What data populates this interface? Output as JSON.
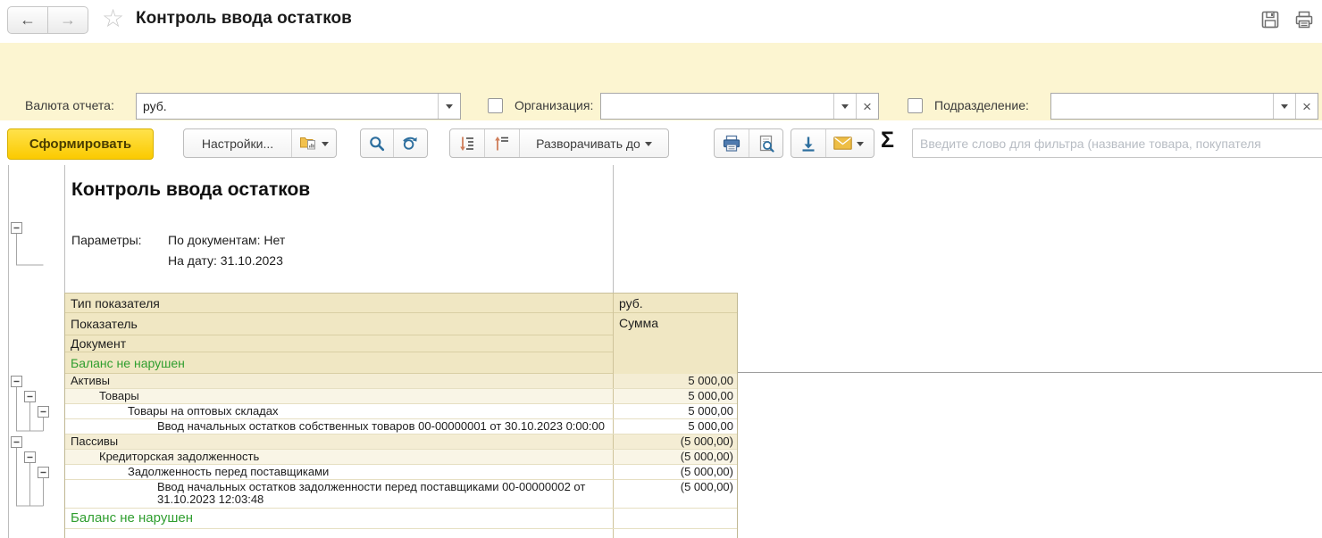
{
  "header": {
    "title": "Контроль ввода остатков",
    "back_glyph": "←",
    "forward_glyph": "→",
    "star_glyph": "☆"
  },
  "filters": {
    "currency": {
      "label": "Валюта отчета:",
      "value": "руб."
    },
    "organization": {
      "label": "Организация:",
      "value": "",
      "checked": false
    },
    "department": {
      "label": "Подразделение:",
      "value": "",
      "checked": false
    },
    "date": {
      "label": "На дату:",
      "value": "31.10.2023"
    }
  },
  "toolbar": {
    "generate_label": "Сформировать",
    "settings_label": "Настройки...",
    "expand_to_label": "Разворачивать до",
    "sigma": "Σ",
    "filter_placeholder": "Введите слово для фильтра (название товара, покупателя"
  },
  "report": {
    "title": "Контроль ввода остатков",
    "parameters_label": "Параметры:",
    "parameter_documents": "По документам: Нет",
    "parameter_date": "На дату: 31.10.2023",
    "unit_label": "руб.",
    "sum_label": "Сумма",
    "header_cells": [
      {
        "label": "Тип показателя"
      },
      {
        "label": "Показатель"
      },
      {
        "label": "Документ"
      },
      {
        "label": "Баланс не нарушен",
        "green": true
      }
    ],
    "rows": [
      {
        "text": "Активы",
        "value": "5 000,00",
        "level": 1,
        "shade": "dark"
      },
      {
        "text": "Товары",
        "value": "5 000,00",
        "level": 2,
        "shade": "light"
      },
      {
        "text": "Товары на оптовых складах",
        "value": "5 000,00",
        "level": 3,
        "shade": "none"
      },
      {
        "text": "Ввод начальных остатков собственных товаров 00-00000001 от 30.10.2023 0:00:00",
        "value": "5 000,00",
        "level": 4,
        "shade": "none"
      },
      {
        "text": "Пассивы",
        "value": "(5 000,00)",
        "level": 1,
        "shade": "dark"
      },
      {
        "text": "Кредиторская задолженность",
        "value": "(5 000,00)",
        "level": 2,
        "shade": "light"
      },
      {
        "text": "Задолженность перед поставщиками",
        "value": "(5 000,00)",
        "level": 3,
        "shade": "none"
      },
      {
        "text": "Ввод начальных остатков задолженности перед поставщиками 00-00000002 от 31.10.2023 12:03:48",
        "value": "(5 000,00)",
        "level": 4,
        "shade": "none",
        "tall": true
      },
      {
        "text": "Баланс не нарушен",
        "value": "",
        "level": 0,
        "shade": "none",
        "status": true
      },
      {
        "text": "",
        "value": "",
        "level": 0,
        "shade": "none",
        "empty": true
      }
    ]
  },
  "colors": {
    "panel_yellow": "#fcf5d1",
    "accent_yellow": "#fbca00",
    "highlight_red": "#d8271c",
    "status_green": "#2f9e2f",
    "header_beige": "#f0e7c3",
    "icon_blue": "#2c6e9e",
    "mail_yellow": "#eebe45"
  }
}
